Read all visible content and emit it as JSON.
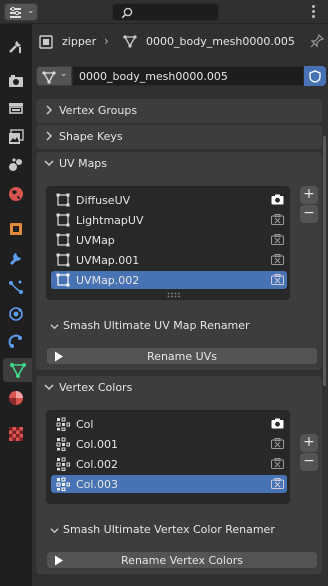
{
  "header": {
    "search_placeholder": ""
  },
  "context": {
    "object_name": "zipper",
    "separator": "›",
    "mesh_name": "0000_body_mesh0000.005"
  },
  "datablock": {
    "name": "0000_body_mesh0000.005"
  },
  "panels": {
    "vertex_groups": {
      "label": "Vertex Groups"
    },
    "shape_keys": {
      "label": "Shape Keys"
    },
    "uv_maps": {
      "label": "UV Maps",
      "items": [
        "DiffuseUV",
        "LightmapUV",
        "UVMap",
        "UVMap.001",
        "UVMap.002"
      ],
      "selected_index": 4,
      "active_render_index": 0,
      "subpanel_label": "Smash Ultimate UV Map Renamer",
      "button_label": "Rename UVs"
    },
    "vertex_colors": {
      "label": "Vertex Colors",
      "items": [
        "Col",
        "Col.001",
        "Col.002",
        "Col.003"
      ],
      "selected_index": 3,
      "active_render_index": 0,
      "subpanel_label": "Smash Ultimate Vertex Color Renamer",
      "button_label": "Rename Vertex Colors"
    }
  },
  "list_controls": {
    "add": "+",
    "remove": "−"
  },
  "colors": {
    "accent": "#4772b3",
    "panel": "#3d3d3d",
    "background": "#303030",
    "list": "#282828"
  }
}
